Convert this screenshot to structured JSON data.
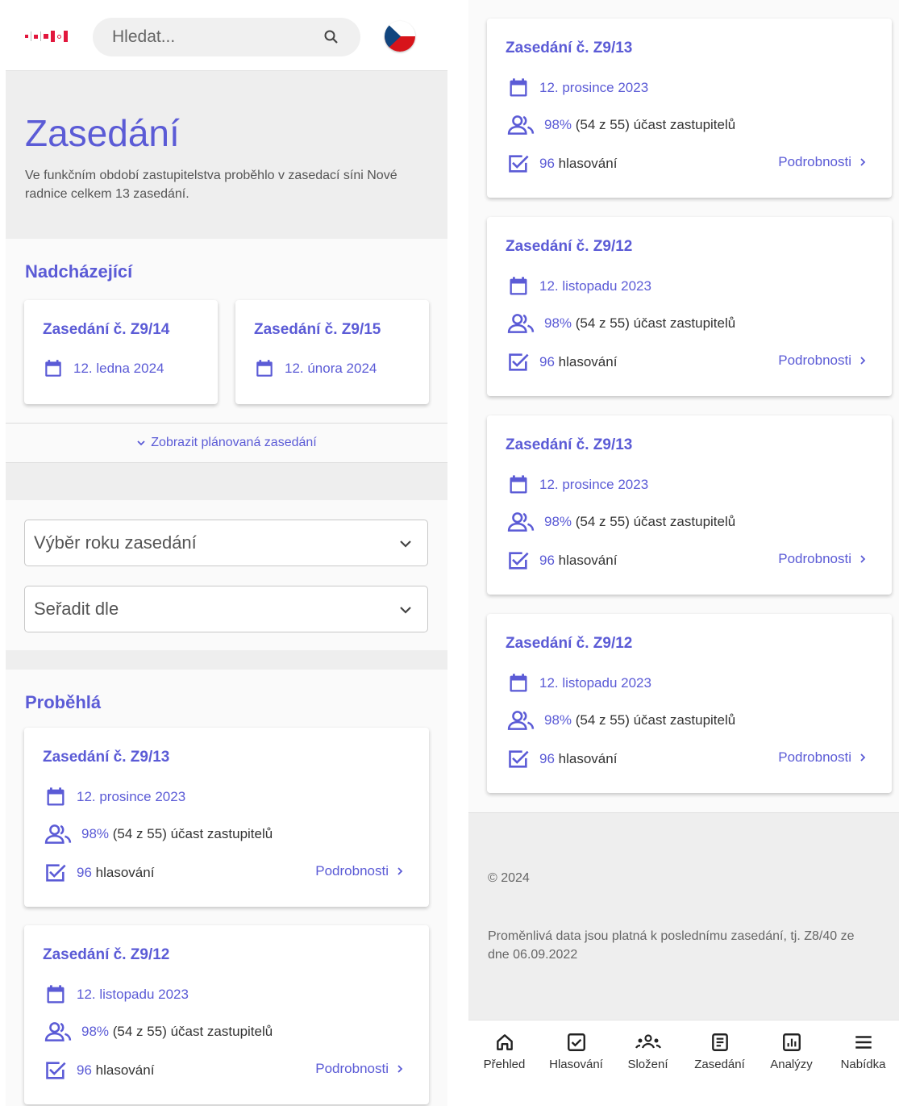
{
  "search": {
    "placeholder": "Hledat..."
  },
  "hero": {
    "title": "Zasedání",
    "text": "Ve funkčním období zastupitelstva proběhlo v zasedací síni Nové radnice celkem 13 zasedání."
  },
  "upcoming": {
    "title": "Nadcházející",
    "items": [
      {
        "title": "Zasedání č. Z9/14",
        "date": "12. ledna 2024"
      },
      {
        "title": "Zasedání č. Z9/15",
        "date": "12. února 2024"
      }
    ],
    "toggle_label": "Zobrazit plánovaná zasedání"
  },
  "filters": {
    "year_placeholder": "Výběr roku zasedání",
    "sort_placeholder": "Seřadit dle"
  },
  "past": {
    "title": "Proběhlá",
    "items": [
      {
        "title": "Zasedání č. Z9/13",
        "date": "12. prosince 2023",
        "attendance_pct": "98%",
        "attendance_text": "(54 z 55) účast zastupitelů",
        "votes_count": "96",
        "votes_label": "hlasování",
        "details": "Podrobnosti"
      },
      {
        "title": "Zasedání č. Z9/12",
        "date": "12. listopadu 2023",
        "attendance_pct": "98%",
        "attendance_text": "(54 z 55) účast zastupitelů",
        "votes_count": "96",
        "votes_label": "hlasování",
        "details": "Podrobnosti"
      }
    ]
  },
  "right_list": [
    {
      "title": "Zasedání č. Z9/13",
      "date": "12. prosince 2023",
      "attendance_pct": "98%",
      "attendance_text": "(54 z 55) účast zastupitelů",
      "votes_count": "96",
      "votes_label": "hlasování",
      "details": "Podrobnosti"
    },
    {
      "title": "Zasedání č. Z9/12",
      "date": "12. listopadu 2023",
      "attendance_pct": "98%",
      "attendance_text": "(54 z 55) účast zastupitelů",
      "votes_count": "96",
      "votes_label": "hlasování",
      "details": "Podrobnosti"
    },
    {
      "title": "Zasedání č. Z9/13",
      "date": "12. prosince 2023",
      "attendance_pct": "98%",
      "attendance_text": "(54 z 55) účast zastupitelů",
      "votes_count": "96",
      "votes_label": "hlasování",
      "details": "Podrobnosti"
    },
    {
      "title": "Zasedání č. Z9/12",
      "date": "12. listopadu 2023",
      "attendance_pct": "98%",
      "attendance_text": "(54 z 55) účast zastupitelů",
      "votes_count": "96",
      "votes_label": "hlasování",
      "details": "Podrobnosti"
    }
  ],
  "footer": {
    "copyright": "© 2024",
    "note": "Proměnlivá data jsou platná k poslednímu zasedání, tj. Z8/40 ze dne 06.09.2022"
  },
  "nav": [
    {
      "label": "Přehled",
      "icon": "home-icon"
    },
    {
      "label": "Hlasování",
      "icon": "checkbox-icon"
    },
    {
      "label": "Složení",
      "icon": "group-icon"
    },
    {
      "label": "Zasedání",
      "icon": "document-icon"
    },
    {
      "label": "Analýzy",
      "icon": "chart-icon"
    },
    {
      "label": "Nabídka",
      "icon": "menu-icon"
    }
  ],
  "colors": {
    "accent": "#5b5bd6",
    "brand_red": "#e2173d"
  }
}
